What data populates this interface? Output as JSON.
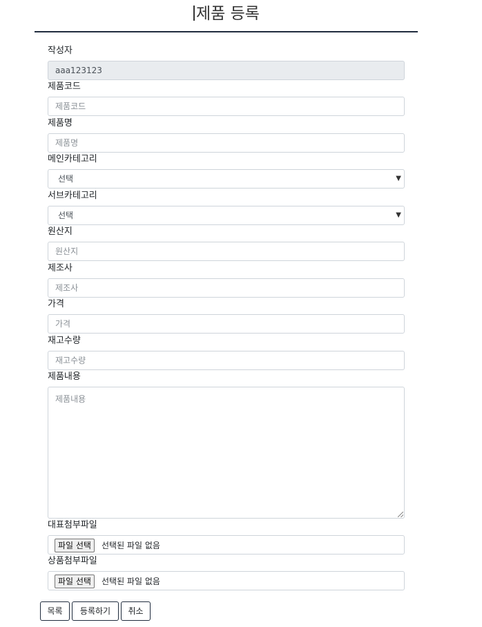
{
  "page": {
    "title": "제품 등록"
  },
  "form": {
    "writer": {
      "label": "작성자",
      "value": "aaa123123"
    },
    "product_code": {
      "label": "제품코드",
      "placeholder": "제품코드"
    },
    "product_name": {
      "label": "제품명",
      "placeholder": "제품명"
    },
    "main_category": {
      "label": "메인카테고리",
      "selected": "선택"
    },
    "sub_category": {
      "label": "서브카테고리",
      "selected": "선택"
    },
    "origin": {
      "label": "원산지",
      "placeholder": "원산지"
    },
    "manufacturer": {
      "label": "제조사",
      "placeholder": "제조사"
    },
    "price": {
      "label": "가격",
      "placeholder": "가격"
    },
    "stock": {
      "label": "재고수량",
      "placeholder": "재고수량"
    },
    "description": {
      "label": "제품내용",
      "placeholder": "제품내용"
    },
    "main_attachment": {
      "label": "대표첨부파일",
      "button_label": "파일 선택",
      "status": "선택된 파일 없음"
    },
    "product_attachment": {
      "label": "상품첨부파일",
      "button_label": "파일 선택",
      "status": "선택된 파일 없음"
    }
  },
  "actions": {
    "list_label": "목록",
    "register_label": "등록하기",
    "cancel_label": "취소"
  },
  "icons": {
    "select_caret": "caret-down-icon",
    "textarea_resize": "resize-grip-icon"
  },
  "colors": {
    "title_rule": "#1f2b3d",
    "readonly_bg": "#e9ecef",
    "border": "#ced4da"
  }
}
